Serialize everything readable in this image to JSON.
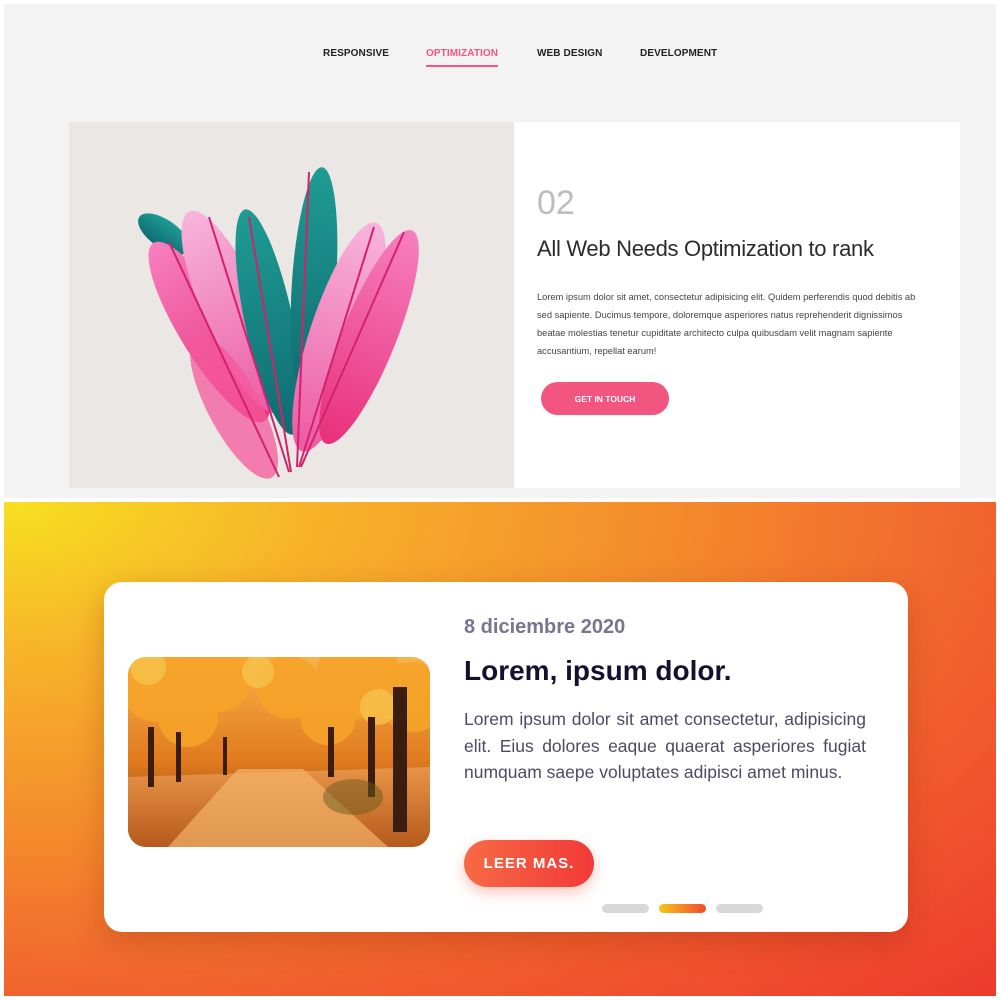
{
  "nav": {
    "items": [
      {
        "label": "RESPONSIVE"
      },
      {
        "label": "OPTIMIZATION"
      },
      {
        "label": "WEB DESIGN"
      },
      {
        "label": "DEVELOPMENT"
      }
    ],
    "active_index": 1
  },
  "feature": {
    "image": "pink-and-teal-feathers-photo",
    "number": "02",
    "title": "All Web Needs Optimization to rank",
    "body": "Lorem ipsum dolor sit amet, consectetur adipisicing elit. Quidem perferendis quod debitis ab sed sapiente. Ducimus tempore, doloremque asperiores natus reprehenderit dignissimos beatae molestias tenetur cupiditate architecto culpa quibusdam velit magnam sapiente accusantium, repellat earum!",
    "button_label": "GET IN TOUCH"
  },
  "card": {
    "image": "autumn-forest-path-photo",
    "date": "8 diciembre 2020",
    "title": "Lorem, ipsum dolor.",
    "body": "Lorem ipsum dolor sit amet consectetur, adipisicing elit. Eius dolores eaque quaerat asperiores fugiat numquam saepe voluptates adipisci amet minus.",
    "button_label": "LEER MAS.",
    "pagination": {
      "count": 3,
      "active_index": 1
    }
  },
  "colors": {
    "accent_pink": "#f2557f",
    "gradient_start": "#f7e020",
    "gradient_end": "#ee3a2c",
    "button_orange": "#f86a45"
  }
}
